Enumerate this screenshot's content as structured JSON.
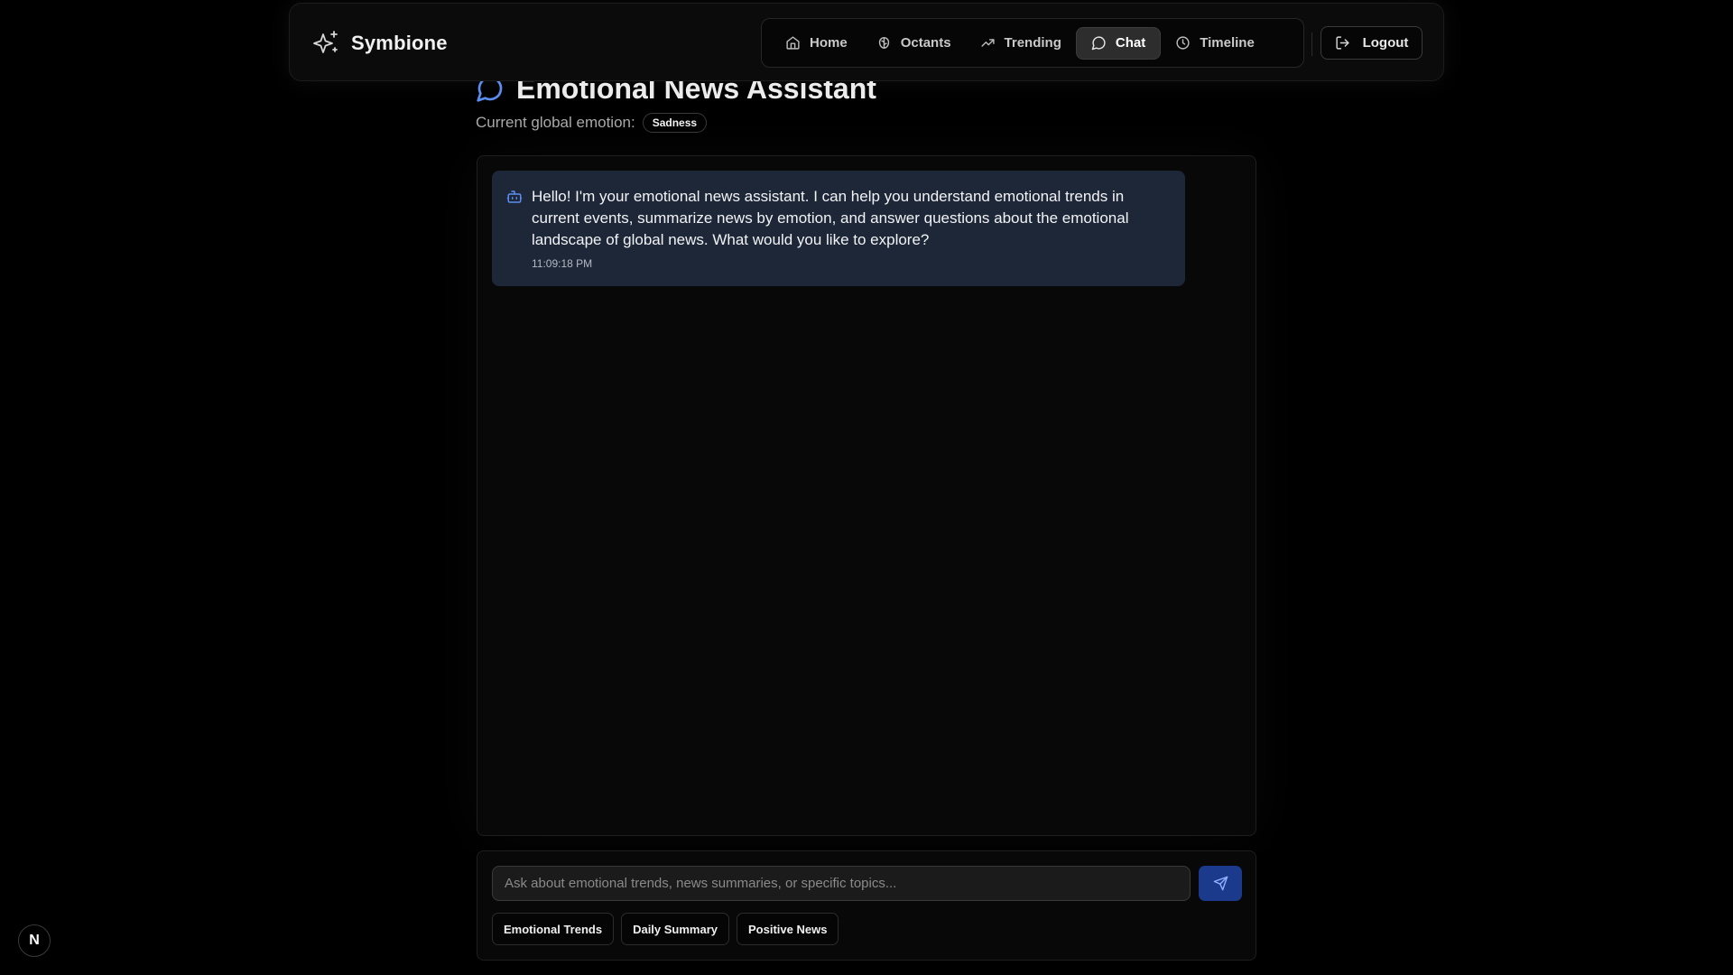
{
  "header": {
    "brand_name": "Symbione",
    "brand_icon": "sparkles-icon",
    "nav": [
      {
        "label": "Home",
        "icon": "home-icon",
        "active": false
      },
      {
        "label": "Octants",
        "icon": "brain-icon",
        "active": false
      },
      {
        "label": "Trending",
        "icon": "trending-up-icon",
        "active": false
      },
      {
        "label": "Chat",
        "icon": "message-circle-icon",
        "active": true
      },
      {
        "label": "Timeline",
        "icon": "clock-icon",
        "active": false
      }
    ],
    "logout_label": "Logout",
    "logout_icon": "logout-icon"
  },
  "main": {
    "title": "Emotional News Assistant",
    "title_icon": "message-circle-icon",
    "emotion_label": "Current global emotion:",
    "emotion_value": "Sadness"
  },
  "chat": {
    "messages": [
      {
        "role": "assistant",
        "icon": "bot-icon",
        "text": "Hello! I'm your emotional news assistant. I can help you understand emotional trends in current events, summarize news by emotion, and answer questions about the emotional landscape of global news. What would you like to explore?",
        "time": "11:09:18 PM"
      }
    ]
  },
  "composer": {
    "placeholder": "Ask about emotional trends, news summaries, or specific topics...",
    "value": "",
    "send_icon": "send-icon",
    "suggestions": [
      "Emotional Trends",
      "Daily Summary",
      "Positive News"
    ]
  },
  "dev_badge": "N",
  "colors": {
    "background": "#000000",
    "bubble": "#1e2737",
    "send_button": "#1b3a8c",
    "accent_icon": "#5b8def"
  }
}
